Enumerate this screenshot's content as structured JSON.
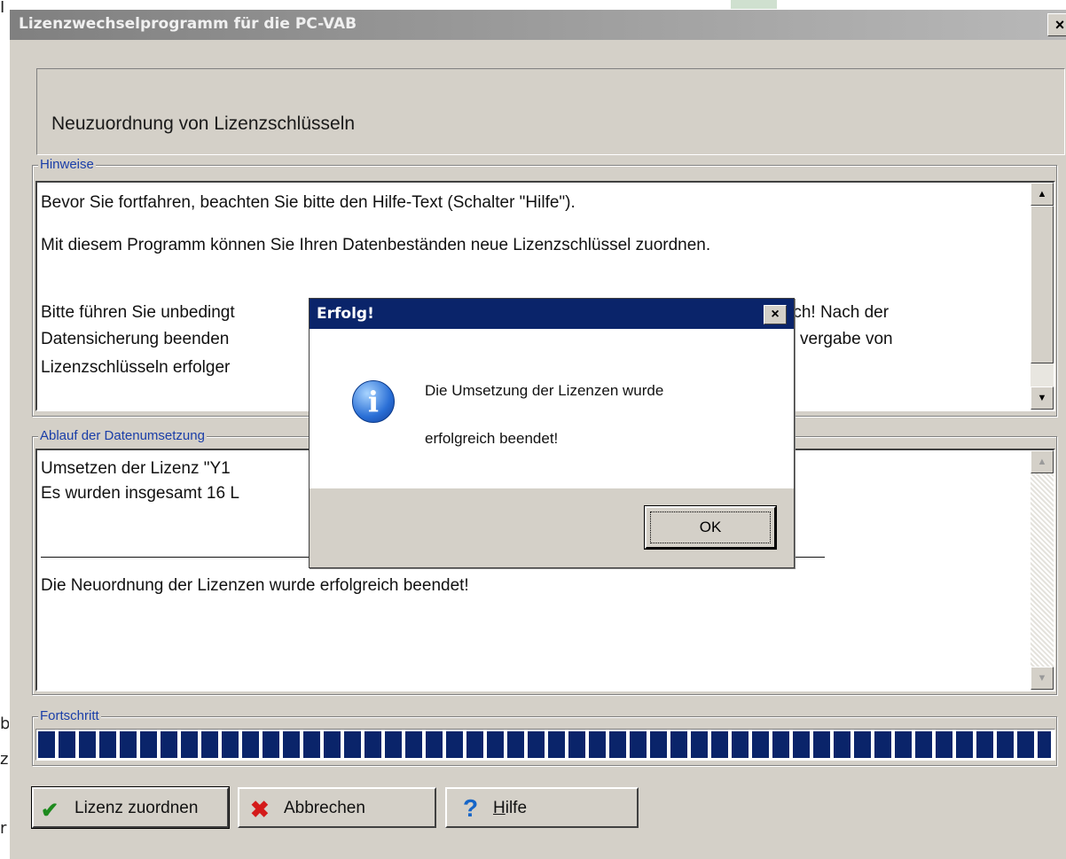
{
  "background_fragments": [
    "I",
    "b",
    "z",
    "r"
  ],
  "window": {
    "title": "Lizenzwechselprogramm für die PC-VAB",
    "close_glyph": "×"
  },
  "header": {
    "heading": "Neuzuordnung von Lizenzschlüsseln"
  },
  "hinweise": {
    "legend": "Hinweise",
    "paragraphs": [
      "Bevor Sie fortfahren, beachten Sie bitte den Hilfe-Text (Schalter \"Hilfe\").",
      "Mit diesem Programm können Sie Ihren Datenbeständen neue Lizenzschlüssel zuordnen.",
      "Bitte führen Sie unbedingt",
      "Datensicherung beenden",
      "Lizenzschlüsseln erfolger",
      "rch! Nach der",
      "vergabe von"
    ]
  },
  "ablauf": {
    "legend": "Ablauf der Datenumsetzung",
    "line1": "Umsetzen der Lizenz \"Y1",
    "line2": "Es wurden insgesamt 16 L",
    "line3": "Die Neuordnung der Lizenzen wurde erfolgreich beendet!"
  },
  "progress": {
    "legend": "Fortschritt",
    "fraction": 1.0
  },
  "buttons": {
    "assign": "Lizenz zuordnen",
    "cancel": "Abbrechen",
    "help_mnemonic": "H",
    "help_rest": "ilfe"
  },
  "dialog": {
    "title": "Erfolg!",
    "icon": "info-icon",
    "message_line1": "Die Umsetzung der Lizenzen wurde",
    "message_line2": "erfolgreich beendet!",
    "ok": "OK"
  },
  "colors": {
    "window_bg": "#d4d0c8",
    "dialog_title_bg": "#0a246a",
    "progress_block": "#0a246a",
    "legend_text": "#1a3ea8"
  }
}
